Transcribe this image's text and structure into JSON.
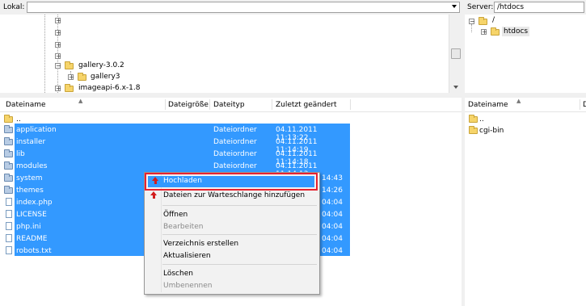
{
  "local": {
    "label": "Lokal:",
    "path": ""
  },
  "remote": {
    "label": "Server:",
    "path": "/htdocs"
  },
  "local_tree": [
    {
      "label": ""
    },
    {
      "label": ""
    },
    {
      "label": ""
    },
    {
      "label": ""
    },
    {
      "label": "gallery-3.0.2"
    },
    {
      "label": "gallery3"
    },
    {
      "label": "imageapi-6.x-1.8"
    }
  ],
  "remote_tree": [
    {
      "label": "/"
    },
    {
      "label": "htdocs"
    }
  ],
  "local_headers": {
    "name": "Dateiname",
    "size": "Dateigröße",
    "type": "Dateityp",
    "modified": "Zuletzt geändert"
  },
  "remote_headers": {
    "name": "Dateiname",
    "size": "D"
  },
  "local_files": [
    {
      "name": "..",
      "type": "",
      "modified": ""
    },
    {
      "name": "application",
      "type": "Dateiordner",
      "modified": "04.11.2011 11:13:22"
    },
    {
      "name": "installer",
      "type": "Dateiordner",
      "modified": "04.11.2011 11:14:19"
    },
    {
      "name": "lib",
      "type": "Dateiordner",
      "modified": "04.11.2011 11:14:18"
    },
    {
      "name": "modules",
      "type": "Dateiordner",
      "modified": "04.11.2011 11:14:13"
    },
    {
      "name": "system",
      "type": "",
      "modified": "14:43"
    },
    {
      "name": "themes",
      "type": "",
      "modified": "14:26"
    },
    {
      "name": "index.php",
      "type": "",
      "modified": "04:04"
    },
    {
      "name": "LICENSE",
      "type": "",
      "modified": "04:04"
    },
    {
      "name": "php.ini",
      "type": "",
      "modified": "04:04"
    },
    {
      "name": "README",
      "type": "",
      "modified": "04:04"
    },
    {
      "name": "robots.txt",
      "type": "",
      "modified": "04:04"
    }
  ],
  "remote_files": [
    {
      "name": ".."
    },
    {
      "name": "cgi-bin"
    }
  ],
  "context_menu": {
    "upload": "Hochladen",
    "queue": "Dateien zur Warteschlange hinzufügen",
    "open": "Öffnen",
    "edit": "Bearbeiten",
    "mkdir": "Verzeichnis erstellen",
    "refresh": "Aktualisieren",
    "delete": "Löschen",
    "rename": "Umbenennen"
  },
  "colors": {
    "selection": "#3399ff",
    "highlight_border": "#e8222f",
    "upload_arrow": "#d21d1d"
  }
}
